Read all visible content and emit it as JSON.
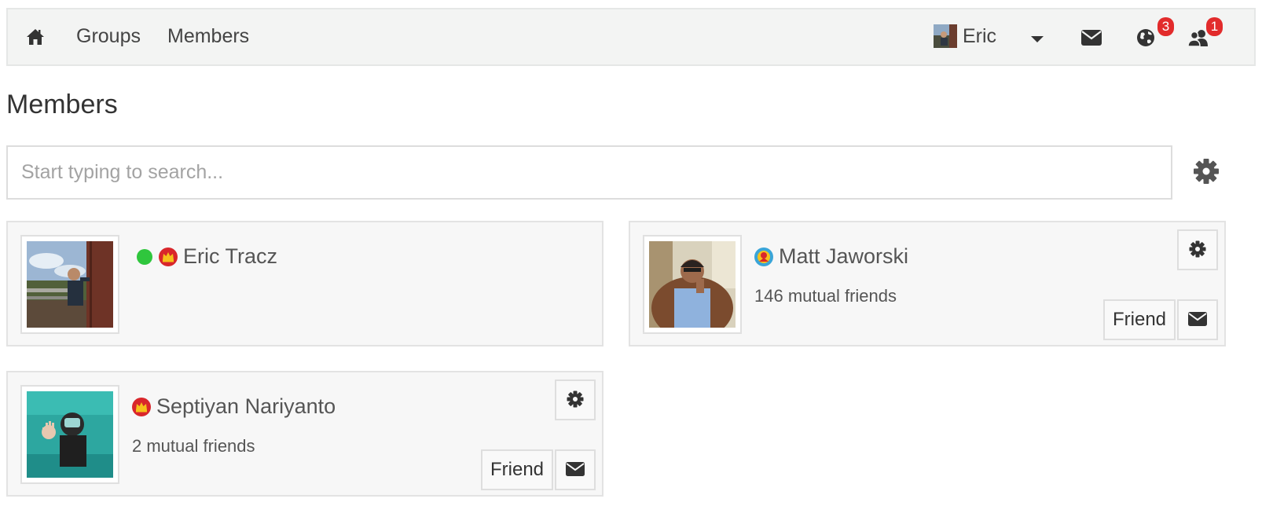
{
  "nav": {
    "home_icon": "home-icon",
    "links": [
      "Groups",
      "Members"
    ],
    "user": {
      "name": "Eric",
      "avatar_icon": "user-avatar-thumbnail"
    },
    "caret_icon": "caret-down-icon",
    "icons": {
      "mail": "envelope-icon",
      "globe": {
        "icon": "globe-icon",
        "badge": "3"
      },
      "friends": {
        "icon": "friends-icon",
        "badge": "1"
      }
    }
  },
  "page": {
    "title": "Members"
  },
  "search": {
    "placeholder": "Start typing to search...",
    "settings_icon": "gear-icon"
  },
  "colors": {
    "online": "#2fc63d",
    "badge": "#e22b2b",
    "crown_badge_bg": "#d9262b",
    "crown_gold": "#f6c01b",
    "rank_badge_ring": "#3aa5d8"
  },
  "members": [
    {
      "name": "Eric Tracz",
      "online": true,
      "rank_icon": "crown-icon",
      "mutual": "",
      "actions": []
    },
    {
      "name": "Matt Jaworski",
      "online": false,
      "rank_icon": "member-rank-icon",
      "mutual": "146 mutual friends",
      "actions": [
        "Friend"
      ]
    },
    {
      "name": "Septiyan Nariyanto",
      "online": false,
      "rank_icon": "crown-icon",
      "mutual": "2 mutual friends",
      "actions": [
        "Friend"
      ]
    }
  ]
}
